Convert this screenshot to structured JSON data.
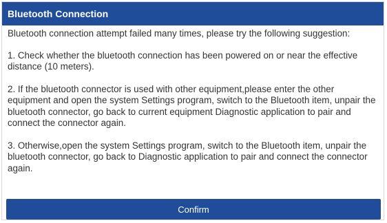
{
  "dialog": {
    "title": "Bluetooth Connection",
    "intro": "Bluetooth connection attempt failed many times, please try the following suggestion:",
    "suggestions": [
      "1. Check whether the bluetooth connection has been powered on or near the effective distance (10 meters).",
      "2. If the bluetooth connector is used with other equipment,please enter the other equipment and open the system Settings program, switch to the Bluetooth item, unpair the bluetooth connector, go back to current equipment Diagnostic application to pair and connect the connector again.",
      "3. Otherwise,open the system Settings program, switch to the Bluetooth item, unpair the bluetooth connector, go back to Diagnostic application to pair and connect the connector again."
    ],
    "confirm_label": "Confirm"
  },
  "colors": {
    "title_bar": "#1f4d99",
    "confirm_button": "#1f4d99",
    "body_text": "#333333"
  }
}
